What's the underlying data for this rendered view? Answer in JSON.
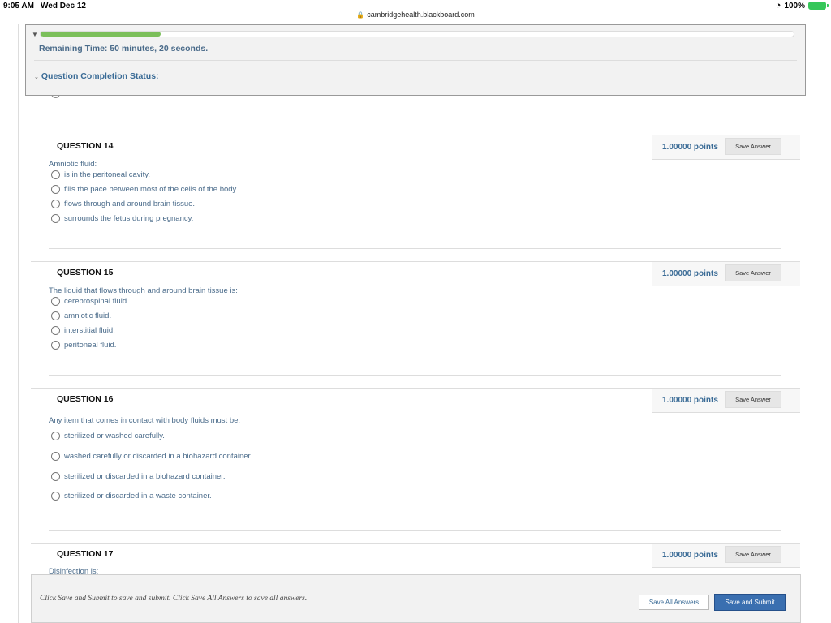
{
  "status_bar": {
    "time": "9:05 AM",
    "date": "Wed Dec 12",
    "battery": "100%"
  },
  "browser": {
    "url": "cambridgehealth.blackboard.com"
  },
  "timer": {
    "progress_fraction": 0.16,
    "remaining_label": "Remaining Time:",
    "remaining_value": "50 minutes, 20 seconds.",
    "completion_label": "Question Completion Status:"
  },
  "questions": [
    {
      "title": "QUESTION 14",
      "points": "1.00000 points",
      "save_label": "Save Answer",
      "text": "Amniotic fluid:",
      "choices": [
        "is in the peritoneal cavity.",
        "fills the pace between most of the cells of the body.",
        "flows through and around brain tissue.",
        "surrounds the fetus during pregnancy."
      ]
    },
    {
      "title": "QUESTION 15",
      "points": "1.00000 points",
      "save_label": "Save Answer",
      "text": "The liquid that flows through and around brain tissue is:",
      "choices": [
        "cerebrospinal fluid.",
        "amniotic fluid.",
        "interstitial fluid.",
        "peritoneal fluid."
      ]
    },
    {
      "title": "QUESTION 16",
      "points": "1.00000 points",
      "save_label": "Save Answer",
      "text": "Any item that comes in contact with body fluids must be:",
      "choices": [
        "sterilized or washed carefully.",
        "washed carefully or discarded in a biohazard container.",
        "sterilized or discarded in a biohazard container.",
        "sterilized or discarded in a waste container."
      ]
    },
    {
      "title": "QUESTION 17",
      "points": "1.00000 points",
      "save_label": "Save Answer",
      "text": "Disinfection is:",
      "choices": []
    }
  ],
  "footer": {
    "instructions": "Click Save and Submit to save and submit. Click Save All Answers to save all answers.",
    "save_all_label": "Save All Answers",
    "submit_label": "Save and Submit"
  }
}
